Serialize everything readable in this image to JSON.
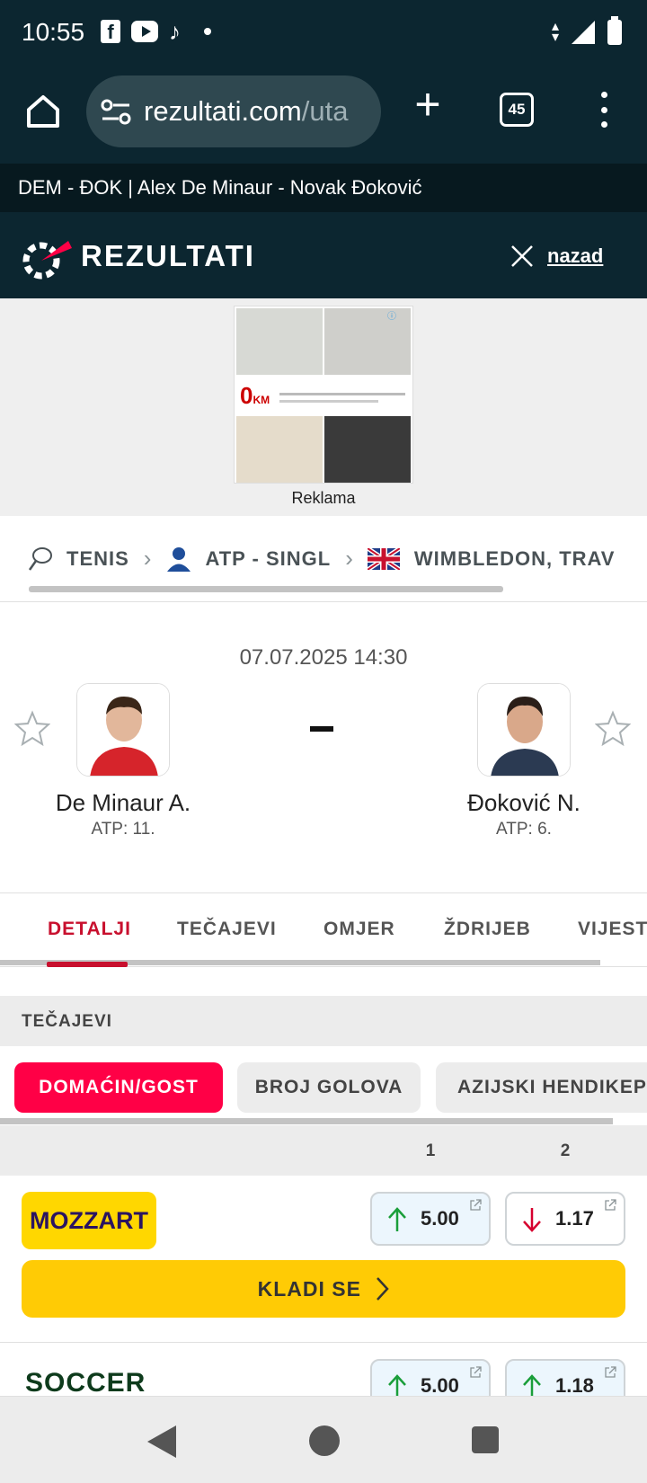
{
  "status_bar": {
    "time": "10:55"
  },
  "browser": {
    "url_main": "rezultati.com",
    "url_dim": "/uta",
    "tab_count": "45"
  },
  "page_title": "DEM - ĐOK | Alex De Minaur - Novak Đoković",
  "site": {
    "logo": "REZULTATI",
    "back_label": "nazad"
  },
  "ad": {
    "price": "0",
    "currency": "KM",
    "label": "Reklama"
  },
  "breadcrumb": [
    {
      "label": "TENIS",
      "icon": "tennis-racket-icon"
    },
    {
      "label": "ATP - SINGL",
      "icon": "person-icon"
    },
    {
      "label": "WIMBLEDON, TRAV",
      "icon": "uk-flag-icon"
    }
  ],
  "match": {
    "date": "07.07.2025 14:30",
    "score": "-",
    "home": {
      "name": "De Minaur A.",
      "rank": "ATP: 11."
    },
    "away": {
      "name": "Đoković N.",
      "rank": "ATP: 6."
    }
  },
  "tabs": [
    "DETALJI",
    "TEČAJEVI",
    "OMJER",
    "ŽDRIJEB",
    "VIJEST"
  ],
  "odds": {
    "section_title": "TEČAJEVI",
    "chips": [
      "DOMAĆIN/GOST",
      "BROJ GOLOVA",
      "AZIJSKI HENDIKEP"
    ],
    "columns": [
      "1",
      "2"
    ],
    "bookmakers": [
      {
        "name": "MOZZART",
        "odd1": "5.00",
        "odd1_trend": "up",
        "odd2": "1.17",
        "odd2_trend": "down",
        "bet_label": "KLADI SE"
      },
      {
        "name": "SOCCER",
        "odd1": "5.00",
        "odd1_trend": "up",
        "odd2": "1.18",
        "odd2_trend": "up"
      }
    ]
  },
  "colors": {
    "accent": "#ff0046",
    "header_bg": "#0c2630",
    "bet_yellow": "#ffcb05",
    "up_green": "#1a9e3a",
    "down_red": "#d6002f"
  }
}
